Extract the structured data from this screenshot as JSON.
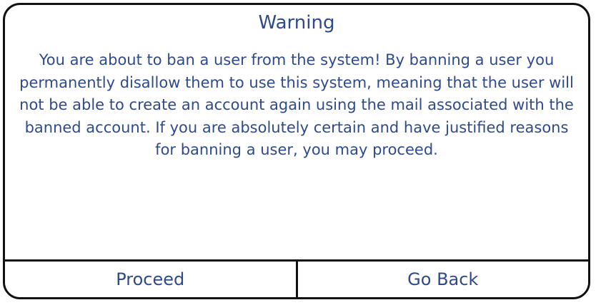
{
  "dialog": {
    "title": "Warning",
    "message": "You are about to ban a user from the system! By banning a user you permanently disallow them to use this system, meaning that the user will not be able to create an account again using the mail associated with the banned account. If you are absolutely certain and have justified reasons for banning a user, you may proceed.",
    "buttons": {
      "proceed": "Proceed",
      "go_back": "Go Back"
    }
  },
  "colors": {
    "text": "#2f4a8a",
    "border": "#111111",
    "background": "#ffffff"
  }
}
